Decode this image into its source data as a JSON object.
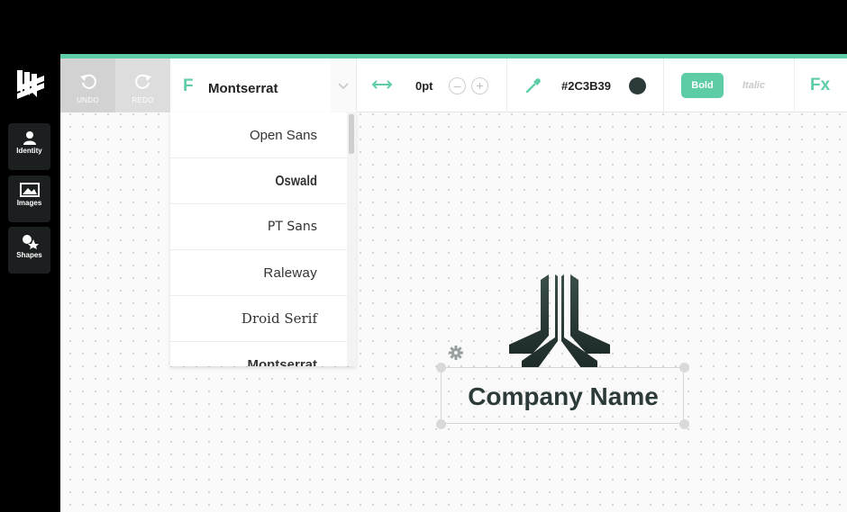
{
  "sidebar": {
    "items": [
      {
        "label": "Identity",
        "icon": "person-icon"
      },
      {
        "label": "Images",
        "icon": "image-icon"
      },
      {
        "label": "Shapes",
        "icon": "shapes-icon"
      }
    ]
  },
  "toolbar": {
    "undo_label": "UNDO",
    "redo_label": "REDO",
    "font_prefix": "F",
    "current_font": "Montserrat",
    "letter_spacing": "0pt",
    "minus_label": "–",
    "plus_label": "+",
    "color_hex": "#2C3B39",
    "bold_label": "Bold",
    "italic_label": "Italic",
    "fx_label": "Fx"
  },
  "font_dropdown": {
    "options": [
      "Open Sans",
      "Oswald",
      "PT Sans",
      "Raleway",
      "Droid Serif",
      "Montserrat"
    ]
  },
  "canvas": {
    "company_name": "Company Name"
  },
  "colors": {
    "accent": "#5ecda6",
    "text_color": "#2c3b39"
  }
}
